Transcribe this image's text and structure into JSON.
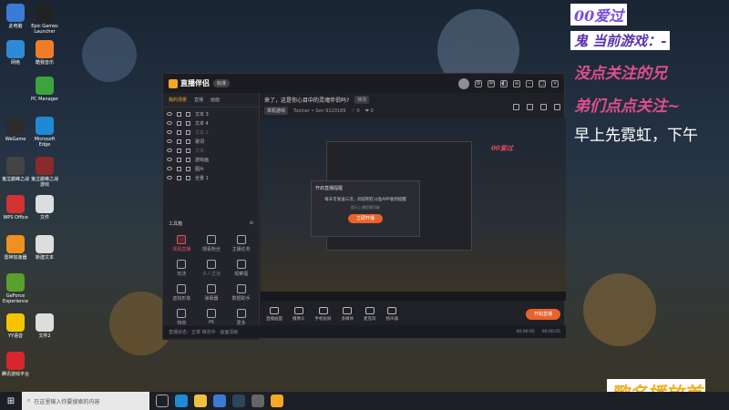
{
  "desktop_icons": [
    {
      "label": "此电脑",
      "color": "#3b7bd6"
    },
    {
      "label": "Epic Games Launcher",
      "color": "#222222"
    },
    {
      "label": "酷我音乐",
      "color": "#f07c2a"
    },
    {
      "label": "网络",
      "color": "#2f8ad6"
    },
    {
      "label": "PC Manager",
      "color": "#3da33d"
    },
    {
      "label": "WeGame",
      "color": "#2c2c2c"
    },
    {
      "label": "Microsoft Edge",
      "color": "#1f8ad3"
    },
    {
      "label": "鬼泣巅峰之战",
      "color": "#444444"
    },
    {
      "label": "鬼泣巅峰之战游戏",
      "color": "#8a2a2a"
    },
    {
      "label": "WPS Office",
      "color": "#d23232"
    },
    {
      "label": "文件",
      "color": "#dddddd"
    },
    {
      "label": "雷神加速器",
      "color": "#f09020"
    },
    {
      "label": "新建文本",
      "color": "#dddddd"
    },
    {
      "label": "GeForce Experience",
      "color": "#5aa02c"
    },
    {
      "label": "YY语音",
      "color": "#f5c400"
    },
    {
      "label": "文件2",
      "color": "#dddddd"
    },
    {
      "label": "腾讯游戏平台",
      "color": "#d9262c"
    }
  ],
  "taskbar": {
    "search_placeholder": "在这里输入你要搜索的内容"
  },
  "overlay": {
    "line1": "00爱过",
    "line2": "鬼    当前游戏：-",
    "line3": "没点关注的兄",
    "line4": "弟们点点关注~",
    "line5": "早上先霓虹，下午",
    "bottom": "歌名播放首"
  },
  "app": {
    "name": "直播伴侣",
    "version_badge": "标准",
    "left_tabs": [
      "我的场景",
      "直播",
      "画面"
    ],
    "scenes": [
      {
        "label": "文本 3",
        "dim": false
      },
      {
        "label": "文本 4",
        "dim": false
      },
      {
        "label": "文本 2",
        "dim": true
      },
      {
        "label": "歌词",
        "dim": false
      },
      {
        "label": "文本",
        "dim": true
      },
      {
        "label": "游戏画",
        "dim": false
      },
      {
        "label": "图片",
        "dim": false
      },
      {
        "label": "全景 1",
        "dim": false
      }
    ],
    "toolbox_title": "工具箱",
    "tools": [
      {
        "label": "观看直播",
        "hot": true,
        "dim": false
      },
      {
        "label": "观看粉丝",
        "hot": false,
        "dim": false
      },
      {
        "label": "主播任务",
        "hot": false,
        "dim": false
      },
      {
        "label": "玩法",
        "hot": false,
        "dim": false
      },
      {
        "label": "多人直播",
        "hot": false,
        "dim": true
      },
      {
        "label": "观察福",
        "hot": false,
        "dim": false
      },
      {
        "label": "虚拟形象",
        "hot": false,
        "dim": false
      },
      {
        "label": "弹幕器",
        "hot": false,
        "dim": false
      },
      {
        "label": "数据助手",
        "hot": false,
        "dim": false
      },
      {
        "label": "特效",
        "hot": false,
        "dim": false
      },
      {
        "label": "PK",
        "hot": false,
        "dim": false
      },
      {
        "label": "更多",
        "hot": false,
        "dim": false
      }
    ],
    "room_title": "来了，这是你心目中的灵魂伴侣吗?",
    "room_tag": "修改",
    "room_category": "单机游戏",
    "room_meta": [
      "Toolner • Sen 9120189",
      "♡ 0",
      "❤ 0"
    ],
    "dialog": {
      "title": "开启直播提醒",
      "text": "每天可发送三次，则说明在斗鱼APP收到提醒",
      "sub": "提示上播提醒功能",
      "button": "立即开播"
    },
    "mini_overlay": "00爱过",
    "bottom_tools": [
      "直播画面",
      "摄像头",
      "手机投屏",
      "多媒体",
      "麦克风",
      "扬声器"
    ],
    "live_button": "开始直播",
    "stats": [
      "00:00:05",
      "00:00:05"
    ],
    "status_text": "直播状态：正常 推流中 · 画面清晰"
  }
}
